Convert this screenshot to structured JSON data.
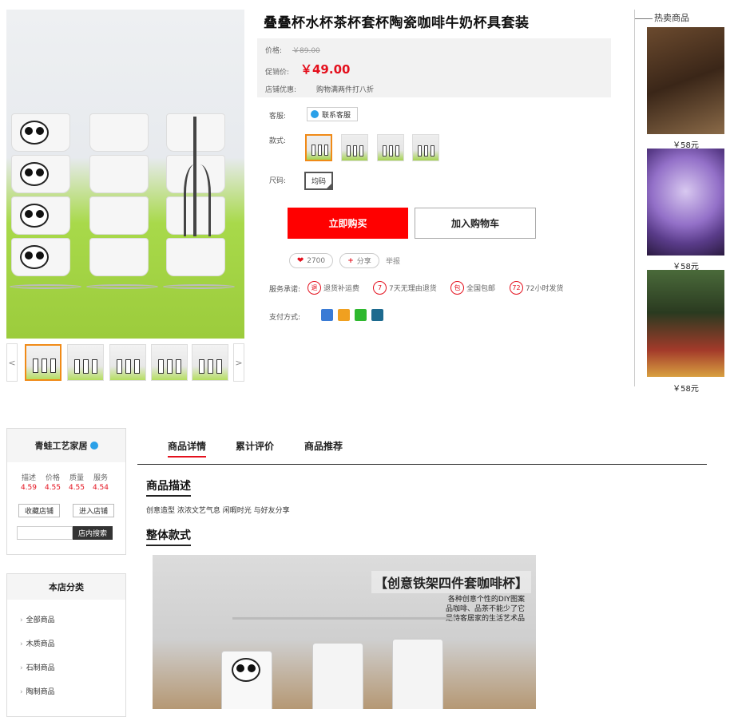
{
  "product": {
    "title": "叠叠杯水杯茶杯套杯陶瓷咖啡牛奶杯具套装",
    "price_label": "价格:",
    "old_price": "￥89.00",
    "promo_price_label": "促销价:",
    "promo_price": "￥49.00",
    "store_promo_label": "店铺优惠:",
    "store_promo": "购物满两件打八折",
    "service_label": "客服:",
    "contact_button": "联系客服",
    "style_label": "款式:",
    "size_label": "尺码:",
    "size_value": "均码",
    "buy_now": "立即购买",
    "add_to_cart": "加入购物车",
    "likes": "2700",
    "share": "分享",
    "report": "举报",
    "promise_label": "服务承诺:",
    "promises": [
      {
        "icon": "退",
        "text": "退货补运费"
      },
      {
        "icon": "7",
        "text": "7天无理由退货"
      },
      {
        "icon": "包",
        "text": "全国包邮"
      },
      {
        "icon": "72",
        "text": "72小时发货"
      }
    ],
    "payment_label": "支付方式:",
    "payment_icons": [
      "credit-card-icon",
      "alipay-icon",
      "wechat-pay-icon",
      "unionpay-icon"
    ],
    "thumb_prev": "<",
    "thumb_next": ">"
  },
  "hot": {
    "title": "热卖商品",
    "items": [
      {
        "price": "￥58元",
        "image": "tea-set"
      },
      {
        "price": "￥58元",
        "image": "crystal-ball"
      },
      {
        "price": "￥58元",
        "image": "fountain-ornament"
      }
    ]
  },
  "shop": {
    "name": "青蛙工艺家居",
    "score_labels": [
      "描述",
      "价格",
      "质量",
      "服务"
    ],
    "score_values": [
      "4.59",
      "4.55",
      "4.55",
      "4.54"
    ],
    "fav_button": "收藏店铺",
    "enter_button": "进入店铺",
    "search_button": "店内搜索"
  },
  "categories": {
    "title": "本店分类",
    "items": [
      "全部商品",
      "木质商品",
      "石制商品",
      "陶制商品"
    ]
  },
  "tabs": [
    "商品详情",
    "累计评价",
    "商品推荐"
  ],
  "detail": {
    "section1": "商品描述",
    "desc": "创意造型 浓浓文艺气息 闲暇时光 与好友分享",
    "section2": "整体款式",
    "banner_title": "【创意铁架四件套咖啡杯】",
    "banner_lines": [
      "各种创意个性的DIY图案",
      "品咖啡、品茶不能少了它",
      "是待客居家的生活艺术品"
    ]
  },
  "colors": {
    "accent": "#e4101d",
    "buy": "#ff0000",
    "selected": "#f08a17"
  }
}
